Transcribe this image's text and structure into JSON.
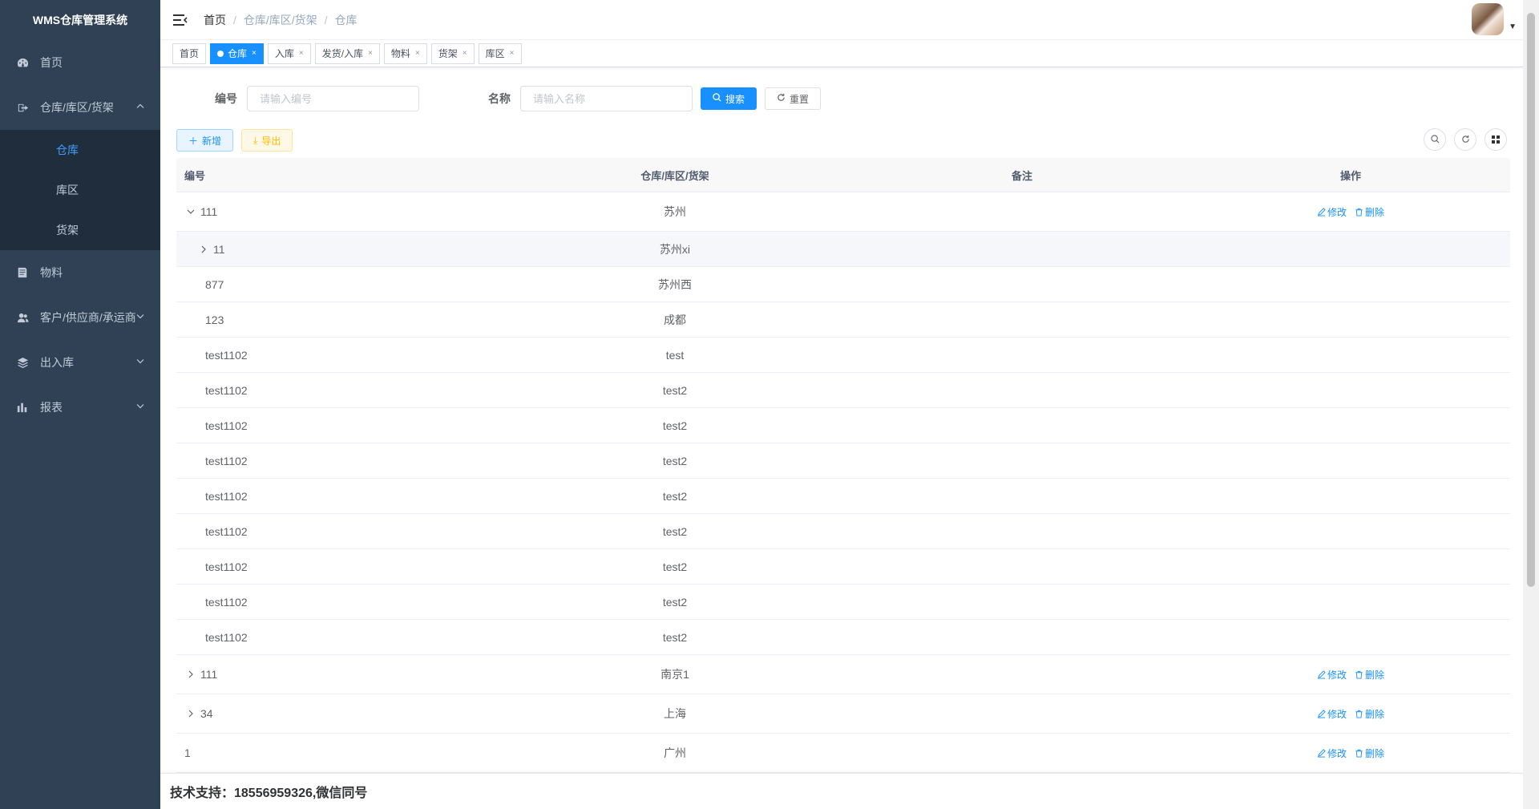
{
  "app": {
    "title": "WMS仓库管理系统"
  },
  "sidebar": {
    "items": [
      {
        "label": "首页",
        "icon": "dashboard-icon"
      },
      {
        "label": "仓库/库区/货架",
        "icon": "export-icon",
        "expanded": true,
        "children": [
          {
            "label": "仓库",
            "active": true
          },
          {
            "label": "库区"
          },
          {
            "label": "货架"
          }
        ]
      },
      {
        "label": "物料",
        "icon": "book-icon"
      },
      {
        "label": "客户/供应商/承运商",
        "icon": "user-group-icon"
      },
      {
        "label": "出入库",
        "icon": "layers-icon"
      },
      {
        "label": "报表",
        "icon": "bar-chart-icon"
      }
    ]
  },
  "breadcrumb": [
    "首页",
    "仓库/库区/货架",
    "仓库"
  ],
  "tags": [
    {
      "label": "首页",
      "active": false,
      "closable": false
    },
    {
      "label": "仓库",
      "active": true,
      "closable": true
    },
    {
      "label": "入库",
      "active": false,
      "closable": true
    },
    {
      "label": "发货/入库",
      "active": false,
      "closable": true
    },
    {
      "label": "物料",
      "active": false,
      "closable": true
    },
    {
      "label": "货架",
      "active": false,
      "closable": true
    },
    {
      "label": "库区",
      "active": false,
      "closable": true
    }
  ],
  "search": {
    "code_label": "编号",
    "code_placeholder": "请输入编号",
    "name_label": "名称",
    "name_placeholder": "请输入名称",
    "search_button": "搜索",
    "reset_button": "重置"
  },
  "toolbar": {
    "add_button": "新增",
    "export_button": "导出"
  },
  "table": {
    "headers": [
      "编号",
      "仓库/库区/货架",
      "备注",
      "操作"
    ],
    "edit_label": "修改",
    "delete_label": "删除",
    "rows": [
      {
        "code": "111",
        "name": "苏州",
        "note": "",
        "level": 0,
        "expander": "down",
        "actions": true
      },
      {
        "code": "11",
        "name": "苏州xi",
        "note": "",
        "level": 1,
        "expander": "right",
        "actions": false,
        "highlight": true
      },
      {
        "code": "877",
        "name": "苏州西",
        "note": "",
        "level": 1,
        "expander": "none",
        "actions": false
      },
      {
        "code": "123",
        "name": "成都",
        "note": "",
        "level": 1,
        "expander": "none",
        "actions": false
      },
      {
        "code": "test1102",
        "name": "test",
        "note": "",
        "level": 1,
        "expander": "none",
        "actions": false
      },
      {
        "code": "test1102",
        "name": "test2",
        "note": "",
        "level": 1,
        "expander": "none",
        "actions": false
      },
      {
        "code": "test1102",
        "name": "test2",
        "note": "",
        "level": 1,
        "expander": "none",
        "actions": false
      },
      {
        "code": "test1102",
        "name": "test2",
        "note": "",
        "level": 1,
        "expander": "none",
        "actions": false
      },
      {
        "code": "test1102",
        "name": "test2",
        "note": "",
        "level": 1,
        "expander": "none",
        "actions": false
      },
      {
        "code": "test1102",
        "name": "test2",
        "note": "",
        "level": 1,
        "expander": "none",
        "actions": false
      },
      {
        "code": "test1102",
        "name": "test2",
        "note": "",
        "level": 1,
        "expander": "none",
        "actions": false
      },
      {
        "code": "test1102",
        "name": "test2",
        "note": "",
        "level": 1,
        "expander": "none",
        "actions": false
      },
      {
        "code": "test1102",
        "name": "test2",
        "note": "",
        "level": 1,
        "expander": "none",
        "actions": false
      },
      {
        "code": "111",
        "name": "南京1",
        "note": "",
        "level": 0,
        "expander": "right",
        "actions": true
      },
      {
        "code": "34",
        "name": "上海",
        "note": "",
        "level": 0,
        "expander": "right",
        "actions": true
      },
      {
        "code": "1",
        "name": "广州",
        "note": "",
        "level": 0,
        "expander": "none",
        "actions": true
      }
    ]
  },
  "footer": {
    "text": "技术支持：18556959326,微信同号"
  },
  "colors": {
    "sidebar_bg": "#304156",
    "submenu_bg": "#1f2d3d",
    "primary": "#1890ff",
    "active_menu": "#409eff"
  }
}
